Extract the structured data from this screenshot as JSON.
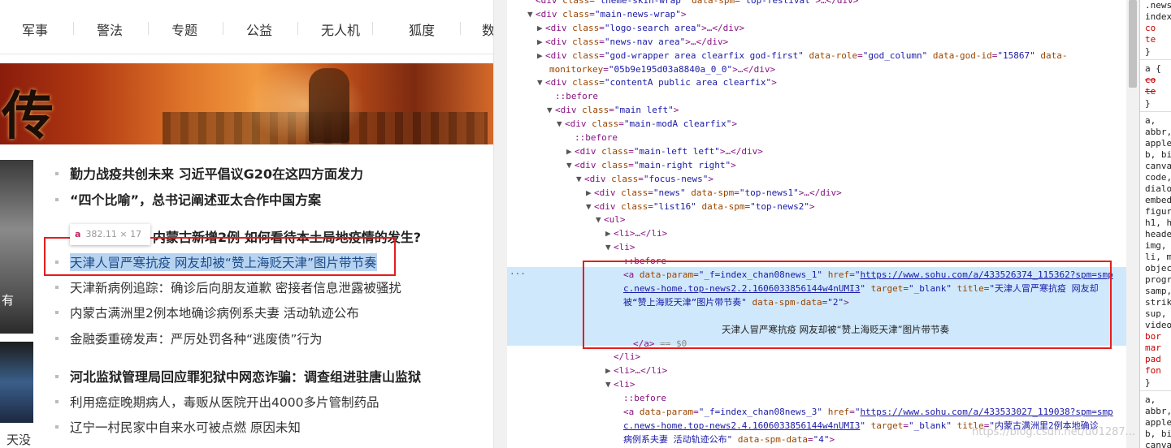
{
  "nav": {
    "items": [
      "军事",
      "警法",
      "专题",
      "公益",
      "无人机",
      "狐度",
      "数"
    ]
  },
  "banner": {
    "calligraphy": "传"
  },
  "side_captions": {
    "img1": "有",
    "img2": "天没"
  },
  "tooltip": {
    "symbol": "a",
    "text": "382.11 × 17"
  },
  "news": [
    {
      "text": "勤力战疫共创未来 习近平倡议G20在这四方面发力",
      "bold": true
    },
    {
      "text": "“四个比喻”，总书记阐述亚太合作中国方案",
      "bold": true
    },
    {
      "text": "例、内蒙古新增2例 如何看待本土局地疫情的发生?",
      "bold": true
    },
    {
      "text": "天津人冒严寒抗疫 网友却被“赞上海贬天津”图片带节奏",
      "bold": false,
      "highlighted": true
    },
    {
      "text": "天津新病例追踪：确诊后向朋友道歉 密接者信息泄露被骚扰",
      "bold": false
    },
    {
      "text": "内蒙古满洲里2例本地确诊病例系夫妻 活动轨迹公布",
      "bold": false
    },
    {
      "text": "金融委重磅发声：严厉处罚各种“逃废债”行为",
      "bold": false
    },
    {
      "text": "河北监狱管理局回应罪犯狱中网恋诈骗：调查组进驻唐山监狱",
      "bold": true
    },
    {
      "text": "利用癌症晚期病人，毒贩从医院开出4000多片管制药品",
      "bold": false
    },
    {
      "text": "辽宁一村民家中自来水可被点燃 原因未知",
      "bold": false
    }
  ],
  "devtools": {
    "lines": [
      {
        "indent": 3,
        "tri": "",
        "html": "<span class='tg'>&lt;div </span><span class='an'>class</span>=<span class='av'>\"theme-skin-wrap\"</span> <span class='an'>data-spm</span>=<span class='av'>\"top-festival\"</span><span class='tg'>&gt;…&lt;/div&gt;</span>"
      },
      {
        "indent": 3,
        "tri": "▼",
        "html": "<span class='tg'>&lt;div </span><span class='an'>class</span>=<span class='av'>\"main-news-wrap\"</span><span class='tg'>&gt;</span>"
      },
      {
        "indent": 4,
        "tri": "▶",
        "html": "<span class='tg'>&lt;div </span><span class='an'>class</span>=<span class='av'>\"logo-search area\"</span><span class='tg'>&gt;…&lt;/div&gt;</span>"
      },
      {
        "indent": 4,
        "tri": "▶",
        "html": "<span class='tg'>&lt;div </span><span class='an'>class</span>=<span class='av'>\"news-nav area\"</span><span class='tg'>&gt;…&lt;/div&gt;</span>"
      },
      {
        "indent": 4,
        "tri": "▶",
        "html": "<span class='tg'>&lt;div </span><span class='an'>class</span>=<span class='av'>\"god-wrapper area clearfix god-first\"</span> <span class='an'>data-role</span>=<span class='av'>\"god_column\"</span> <span class='an'>data-god-id</span>=<span class='av'>\"15867\"</span> <span class='an'>data-</span>"
      },
      {
        "indent": 4,
        "tri": "",
        "wrap": true,
        "html": "<span class='an'>monitorkey</span>=<span class='av'>\"05b9e195d03a8840a_0_0\"</span><span class='tg'>&gt;…&lt;/div&gt;</span>"
      },
      {
        "indent": 4,
        "tri": "▼",
        "html": "<span class='tg'>&lt;div </span><span class='an'>class</span>=<span class='av'>\"contentA public area clearfix\"</span><span class='tg'>&gt;</span>"
      },
      {
        "indent": 5,
        "tri": "",
        "html": "<span class='pe'>::before</span>"
      },
      {
        "indent": 5,
        "tri": "▼",
        "html": "<span class='tg'>&lt;div </span><span class='an'>class</span>=<span class='av'>\"main left\"</span><span class='tg'>&gt;</span>"
      },
      {
        "indent": 6,
        "tri": "▼",
        "html": "<span class='tg'>&lt;div </span><span class='an'>class</span>=<span class='av'>\"main-modA clearfix\"</span><span class='tg'>&gt;</span>"
      },
      {
        "indent": 7,
        "tri": "",
        "html": "<span class='pe'>::before</span>"
      },
      {
        "indent": 7,
        "tri": "▶",
        "html": "<span class='tg'>&lt;div </span><span class='an'>class</span>=<span class='av'>\"main-left left\"</span><span class='tg'>&gt;…&lt;/div&gt;</span>"
      },
      {
        "indent": 7,
        "tri": "▼",
        "html": "<span class='tg'>&lt;div </span><span class='an'>class</span>=<span class='av'>\"main-right right\"</span><span class='tg'>&gt;</span>"
      },
      {
        "indent": 8,
        "tri": "▼",
        "html": "<span class='tg'>&lt;div </span><span class='an'>class</span>=<span class='av'>\"focus-news\"</span><span class='tg'>&gt;</span>"
      },
      {
        "indent": 9,
        "tri": "▶",
        "html": "<span class='tg'>&lt;div </span><span class='an'>class</span>=<span class='av'>\"news\"</span> <span class='an'>data-spm</span>=<span class='av'>\"top-news1\"</span><span class='tg'>&gt;…&lt;/div&gt;</span>"
      },
      {
        "indent": 9,
        "tri": "▼",
        "html": "<span class='tg'>&lt;div </span><span class='an'>class</span>=<span class='av'>\"list16\"</span> <span class='an'>data-spm</span>=<span class='av'>\"top-news2\"</span><span class='tg'>&gt;</span>"
      },
      {
        "indent": 10,
        "tri": "▼",
        "html": "<span class='tg'>&lt;ul&gt;</span>"
      },
      {
        "indent": 11,
        "tri": "▶",
        "html": "<span class='tg'>&lt;li&gt;…&lt;/li&gt;</span>"
      },
      {
        "indent": 11,
        "tri": "▼",
        "html": "<span class='tg'>&lt;li&gt;</span>"
      },
      {
        "indent": 12,
        "tri": "",
        "html": "<span class='pe'>::before</span>"
      },
      {
        "indent": 12,
        "tri": "",
        "html": "<span class='tg'>&lt;a </span><span class='an'>data-param</span>=<span class='av'>\"_f=index_chan08news_1\"</span> <span class='an'>href</span>=<span class='av'>\"</span><span class='au'>https://www.sohu.com/a/433526374_115362?spm=smp</span>"
      },
      {
        "indent": 12,
        "tri": "",
        "html": "<span class='au'>c.news-home.top-news2.2.1606033856144w4nUMI3</span><span class='av'>\"</span> <span class='an'>target</span>=<span class='av'>\"_blank\"</span> <span class='an'>title</span>=<span class='av'>\"天津人冒严寒抗疫 网友却</span>"
      },
      {
        "indent": 12,
        "tri": "",
        "html": "<span class='av'>被“赞上海贬天津”图片带节奏\"</span> <span class='an'>data-spm-data</span>=<span class='av'>\"2\"</span><span class='tg'>&gt;</span>"
      },
      {
        "indent": 0,
        "tri": "",
        "html": ""
      },
      {
        "indent": 0,
        "tri": "",
        "center": true,
        "html": "<span class='tx'>天津人冒严寒抗疫 网友却被“赞上海贬天津”图片带节奏</span>"
      },
      {
        "indent": 13,
        "tri": "",
        "html": "<span class='tg'>&lt;/a&gt;</span> <span class='gr'>== $0</span>"
      },
      {
        "indent": 11,
        "tri": "",
        "html": "<span class='tg'>&lt;/li&gt;</span>"
      },
      {
        "indent": 11,
        "tri": "▶",
        "html": "<span class='tg'>&lt;li&gt;…&lt;/li&gt;</span>"
      },
      {
        "indent": 11,
        "tri": "▼",
        "html": "<span class='tg'>&lt;li&gt;</span>"
      },
      {
        "indent": 12,
        "tri": "",
        "html": "<span class='pe'>::before</span>"
      },
      {
        "indent": 12,
        "tri": "",
        "html": "<span class='tg'>&lt;a </span><span class='an'>data-param</span>=<span class='av'>\"_f=index_chan08news_3\"</span> <span class='an'>href</span>=<span class='av'>\"</span><span class='au'>https://www.sohu.com/a/433533027_119038?spm=smp</span>"
      },
      {
        "indent": 12,
        "tri": "",
        "html": "<span class='au'>c.news-home.top-news2.4.1606033856144w4nUMI3</span><span class='av'>\"</span> <span class='an'>target</span>=<span class='av'>\"_blank\"</span> <span class='an'>title</span>=<span class='av'>\"内蒙古满洲里2例本地确诊</span>"
      },
      {
        "indent": 12,
        "tri": "",
        "html": "<span class='av'>病例系夫妻 活动轨迹公布\"</span> <span class='an'>data-spm-data</span>=<span class='av'>\"4\"</span><span class='tg'>&gt;</span>"
      }
    ],
    "ellipsis": "···"
  },
  "styles_panel": {
    "lines": [
      {
        "t": ".news",
        "c": ""
      },
      {
        "t": "index",
        "c": ""
      },
      {
        "t": "  co",
        "c": "red"
      },
      {
        "t": "  te",
        "c": "red"
      },
      {
        "t": "}",
        "c": ""
      },
      {
        "t": "a {",
        "c": ""
      },
      {
        "t": "  co",
        "c": "strike"
      },
      {
        "t": "  te",
        "c": "strike"
      },
      {
        "t": "}",
        "c": ""
      },
      {
        "t": "a,",
        "c": ""
      },
      {
        "t": "abbr,",
        "c": ""
      },
      {
        "t": "apple",
        "c": ""
      },
      {
        "t": "b, bi",
        "c": ""
      },
      {
        "t": "canva",
        "c": ""
      },
      {
        "t": "code,",
        "c": ""
      },
      {
        "t": "dialo",
        "c": ""
      },
      {
        "t": "embed",
        "c": ""
      },
      {
        "t": "figur",
        "c": ""
      },
      {
        "t": "h1, h",
        "c": ""
      },
      {
        "t": "heade",
        "c": ""
      },
      {
        "t": "img,",
        "c": ""
      },
      {
        "t": "li, m",
        "c": ""
      },
      {
        "t": "objec",
        "c": ""
      },
      {
        "t": "progr",
        "c": ""
      },
      {
        "t": "samp,",
        "c": ""
      },
      {
        "t": "strik",
        "c": ""
      },
      {
        "t": "sup,",
        "c": ""
      },
      {
        "t": "video",
        "c": ""
      },
      {
        "t": "  bor",
        "c": "red"
      },
      {
        "t": "  mar",
        "c": "red"
      },
      {
        "t": "  pad",
        "c": "red"
      },
      {
        "t": "  fon",
        "c": "red"
      },
      {
        "t": "}",
        "c": ""
      },
      {
        "t": "a,",
        "c": ""
      },
      {
        "t": "abbr,",
        "c": ""
      },
      {
        "t": "apple",
        "c": ""
      },
      {
        "t": "b, bi",
        "c": ""
      },
      {
        "t": "canva",
        "c": ""
      }
    ]
  },
  "watermark": "https://blog.csdn.net/u01287..."
}
